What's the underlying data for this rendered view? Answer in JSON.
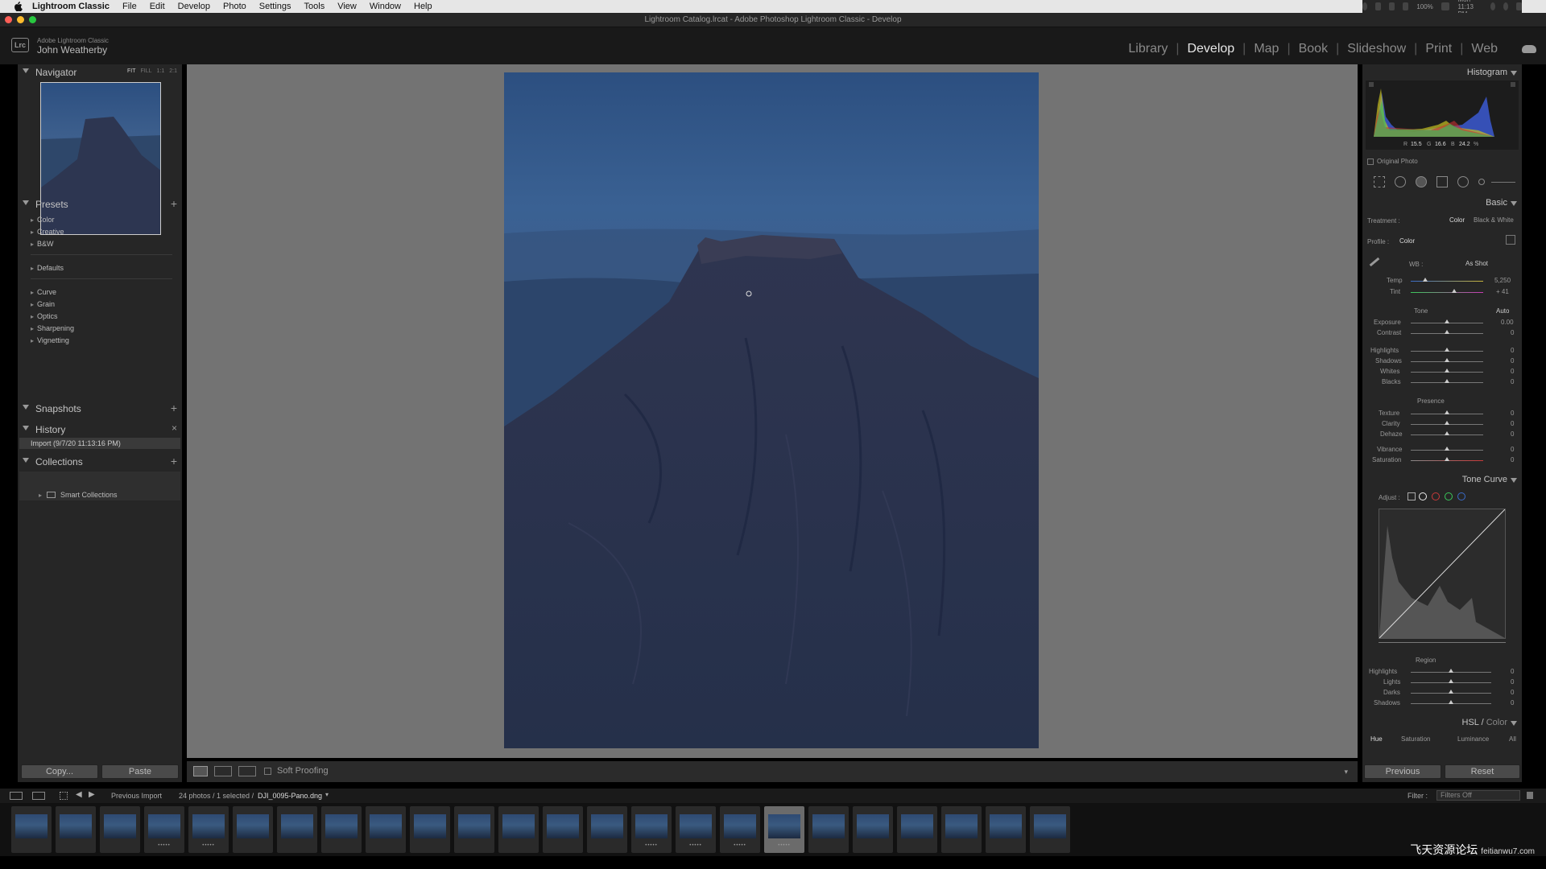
{
  "menubar": {
    "app": "Lightroom Classic",
    "items": [
      "File",
      "Edit",
      "Develop",
      "Photo",
      "Settings",
      "Tools",
      "View",
      "Window",
      "Help"
    ],
    "battery": "100%",
    "clock": "Mon 11:13 PM"
  },
  "window": {
    "title": "Lightroom Catalog.lrcat - Adobe Photoshop Lightroom Classic - Develop"
  },
  "identity": {
    "logo": "Lrc",
    "product": "Adobe Lightroom Classic",
    "user": "John Weatherby"
  },
  "modules": [
    "Library",
    "Develop",
    "Map",
    "Book",
    "Slideshow",
    "Print",
    "Web"
  ],
  "active_module": "Develop",
  "left": {
    "navigator": {
      "title": "Navigator",
      "zoom": [
        "FIT",
        "FILL",
        "1:1",
        "2:1"
      ]
    },
    "presets": {
      "title": "Presets",
      "group1": [
        "Color",
        "Creative",
        "B&W"
      ],
      "group2": [
        "Defaults"
      ],
      "group3": [
        "Curve",
        "Grain",
        "Optics",
        "Sharpening",
        "Vignetting"
      ]
    },
    "snapshots": {
      "title": "Snapshots"
    },
    "history": {
      "title": "History",
      "item": "Import (9/7/20 11:13:16 PM)"
    },
    "collections": {
      "title": "Collections",
      "item": "Smart Collections"
    },
    "copy_label": "Copy...",
    "paste_label": "Paste"
  },
  "toolbar": {
    "soft_proofing": "Soft Proofing"
  },
  "right": {
    "histogram": {
      "title": "Histogram",
      "r_label": "R",
      "r": "15.5",
      "g_label": "G",
      "g": "16.6",
      "b_label": "B",
      "b": "24.2",
      "unit": "%",
      "original_photo": "Original Photo"
    },
    "basic": {
      "title": "Basic",
      "treatment_label": "Treatment :",
      "color": "Color",
      "bw": "Black & White",
      "profile_label": "Profile :",
      "profile": "Color",
      "wb_label": "WB :",
      "wb": "As Shot",
      "temp_label": "Temp",
      "temp": "5,250",
      "tint_label": "Tint",
      "tint": "+ 41",
      "tone_label": "Tone",
      "auto": "Auto",
      "exposure_label": "Exposure",
      "exposure": "0.00",
      "contrast_label": "Contrast",
      "contrast": "0",
      "highlights_label": "Highlights",
      "highlights": "0",
      "shadows_label": "Shadows",
      "shadows": "0",
      "whites_label": "Whites",
      "whites": "0",
      "blacks_label": "Blacks",
      "blacks": "0",
      "presence_label": "Presence",
      "texture_label": "Texture",
      "texture": "0",
      "clarity_label": "Clarity",
      "clarity": "0",
      "dehaze_label": "Dehaze",
      "dehaze": "0",
      "vibrance_label": "Vibrance",
      "vibrance": "0",
      "saturation_label": "Saturation",
      "saturation": "0"
    },
    "tonecurve": {
      "title": "Tone Curve",
      "adjust_label": "Adjust :",
      "region_label": "Region",
      "highlights_label": "Highlights",
      "highlights": "0",
      "lights_label": "Lights",
      "lights": "0",
      "darks_label": "Darks",
      "darks": "0",
      "shadows_label": "Shadows",
      "shadows": "0"
    },
    "hsl": {
      "title_hsl": "HSL",
      "title_color": "Color",
      "tabs": [
        "Hue",
        "Saturation",
        "Luminance",
        "All"
      ]
    },
    "previous_label": "Previous",
    "reset_label": "Reset"
  },
  "filmbar": {
    "source": "Previous Import",
    "count": "24 photos / 1 selected /",
    "filename": "DJI_0095-Pano.dng",
    "filter_label": "Filter :",
    "filter_value": "Filters Off"
  },
  "filmstrip": {
    "count": 24,
    "selected_index": 17,
    "starred": [
      3,
      4,
      14,
      15,
      16,
      17
    ]
  },
  "watermark": {
    "text": "飞天资源论坛",
    "url": "feitianwu7.com"
  },
  "colors": {
    "panel": "#262626",
    "center_bg": "#737373",
    "active_text": "#e6e6e6",
    "sky_top": "#2c4f80",
    "mountain": "#2a3450"
  }
}
